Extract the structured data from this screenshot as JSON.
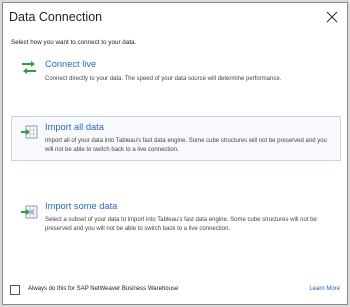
{
  "dialog": {
    "title": "Data Connection",
    "prompt": "Select how you want to connect to your data."
  },
  "options": [
    {
      "title": "Connect live",
      "description": "Connect directly to your data. The speed of your data source will determine performance.",
      "icon": "connect-live-icon",
      "selected": false
    },
    {
      "title": "Import all data",
      "description": "Import all of your data into Tableau's fast data engine. Some cube structures will not be preserved and you will not be able to switch back to a live connection.",
      "icon": "import-all-icon",
      "selected": true
    },
    {
      "title": "Import some data",
      "description": "Select a subset of your data to import into Tableau's fast data engine. Some cube structures will not be preserved and you will not be able to switch back to a live connection.",
      "icon": "import-some-icon",
      "selected": false
    }
  ],
  "footer": {
    "checkbox_label": "Always do this for SAP NetWeaver Business Warehouse",
    "checkbox_checked": false,
    "learn_more": "Learn More"
  },
  "colors": {
    "accent": "#2a6ab6",
    "arrow_green": "#2e9e3f",
    "selected_border": "#c5d3e3"
  }
}
